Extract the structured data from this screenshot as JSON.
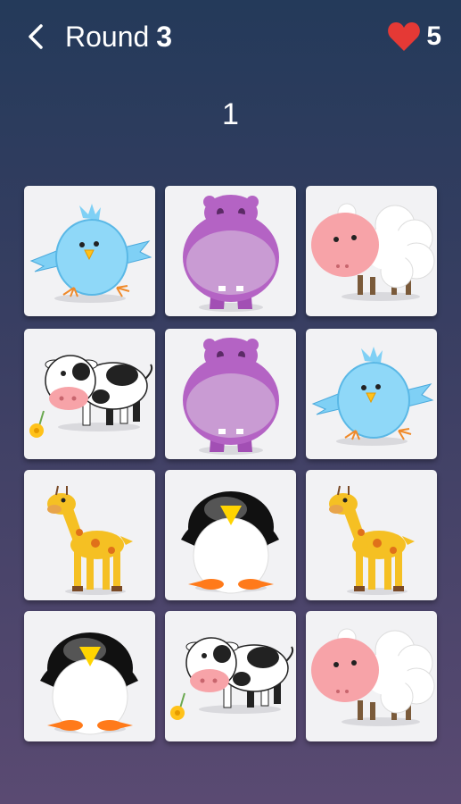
{
  "header": {
    "back_icon": "chevron-left-icon",
    "round_label": "Round",
    "round_number": "3",
    "lives_icon": "heart-icon",
    "lives": "5",
    "accent_color": "#e53935"
  },
  "score": "1",
  "board": {
    "columns": 3,
    "rows": 4,
    "cards": [
      {
        "animal": "bird"
      },
      {
        "animal": "hippo"
      },
      {
        "animal": "sheep"
      },
      {
        "animal": "cow"
      },
      {
        "animal": "hippo"
      },
      {
        "animal": "bird"
      },
      {
        "animal": "giraffe"
      },
      {
        "animal": "penguin"
      },
      {
        "animal": "giraffe"
      },
      {
        "animal": "penguin"
      },
      {
        "animal": "cow"
      },
      {
        "animal": "sheep"
      }
    ]
  }
}
